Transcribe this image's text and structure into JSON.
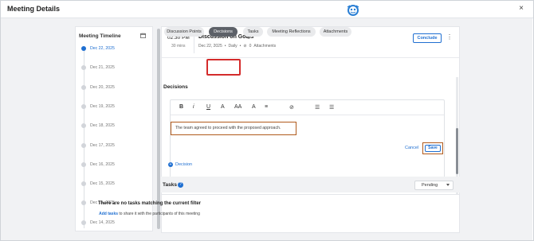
{
  "window": {
    "title": "Meeting Details",
    "close_label": "×"
  },
  "sidebar": {
    "title": "Meeting Timeline",
    "dates": [
      {
        "label": "Dec 22, 2025",
        "active": true
      },
      {
        "label": "Dec 21, 2025",
        "active": false
      },
      {
        "label": "Dec 20, 2025",
        "active": false
      },
      {
        "label": "Dec 19, 2025",
        "active": false
      },
      {
        "label": "Dec 18, 2025",
        "active": false
      },
      {
        "label": "Dec 17, 2025",
        "active": false
      },
      {
        "label": "Dec 16, 2025",
        "active": false
      },
      {
        "label": "Dec 15, 2025",
        "active": false
      },
      {
        "label": "Dec 15, 2025",
        "active": false
      },
      {
        "label": "Dec 14, 2025",
        "active": false
      }
    ]
  },
  "meeting": {
    "time": "02:30 PM",
    "duration": "30 mins",
    "title": "Discussion on Goals",
    "date": "Dec 22, 2025",
    "frequency": "Daily",
    "attachments_count": "0",
    "attachments_label": "Attachments",
    "conclude_label": "Conclude"
  },
  "tabs": [
    {
      "label": "Discussion Points",
      "active": false
    },
    {
      "label": "Decisions",
      "active": true
    },
    {
      "label": "Tasks",
      "active": false
    },
    {
      "label": "Meeting Reflections",
      "active": false
    },
    {
      "label": "Attachments",
      "active": false
    }
  ],
  "decisions": {
    "heading": "Decisions",
    "toolbar": {
      "bold": "B",
      "italic": "i",
      "underline": "U",
      "font_color": "A",
      "font_size": "AA",
      "font_style": "A",
      "align": "≡",
      "link": "⊘",
      "bullets": "☰",
      "numbered": "☰"
    },
    "content": "The team agreed to proceed with the proposed approach.",
    "cancel_label": "Cancel",
    "save_label": "Save",
    "add_label": "Decision"
  },
  "tasks": {
    "heading": "Tasks",
    "filter": "Pending",
    "empty_title": "There are no tasks matching the current filter",
    "add_link": "Add tasks",
    "share_text": " to share it with the participants of this meeting"
  },
  "colors": {
    "accent": "#1f6fd1",
    "highlight_red": "#d42b2b",
    "highlight_orange": "#b05a1c"
  }
}
